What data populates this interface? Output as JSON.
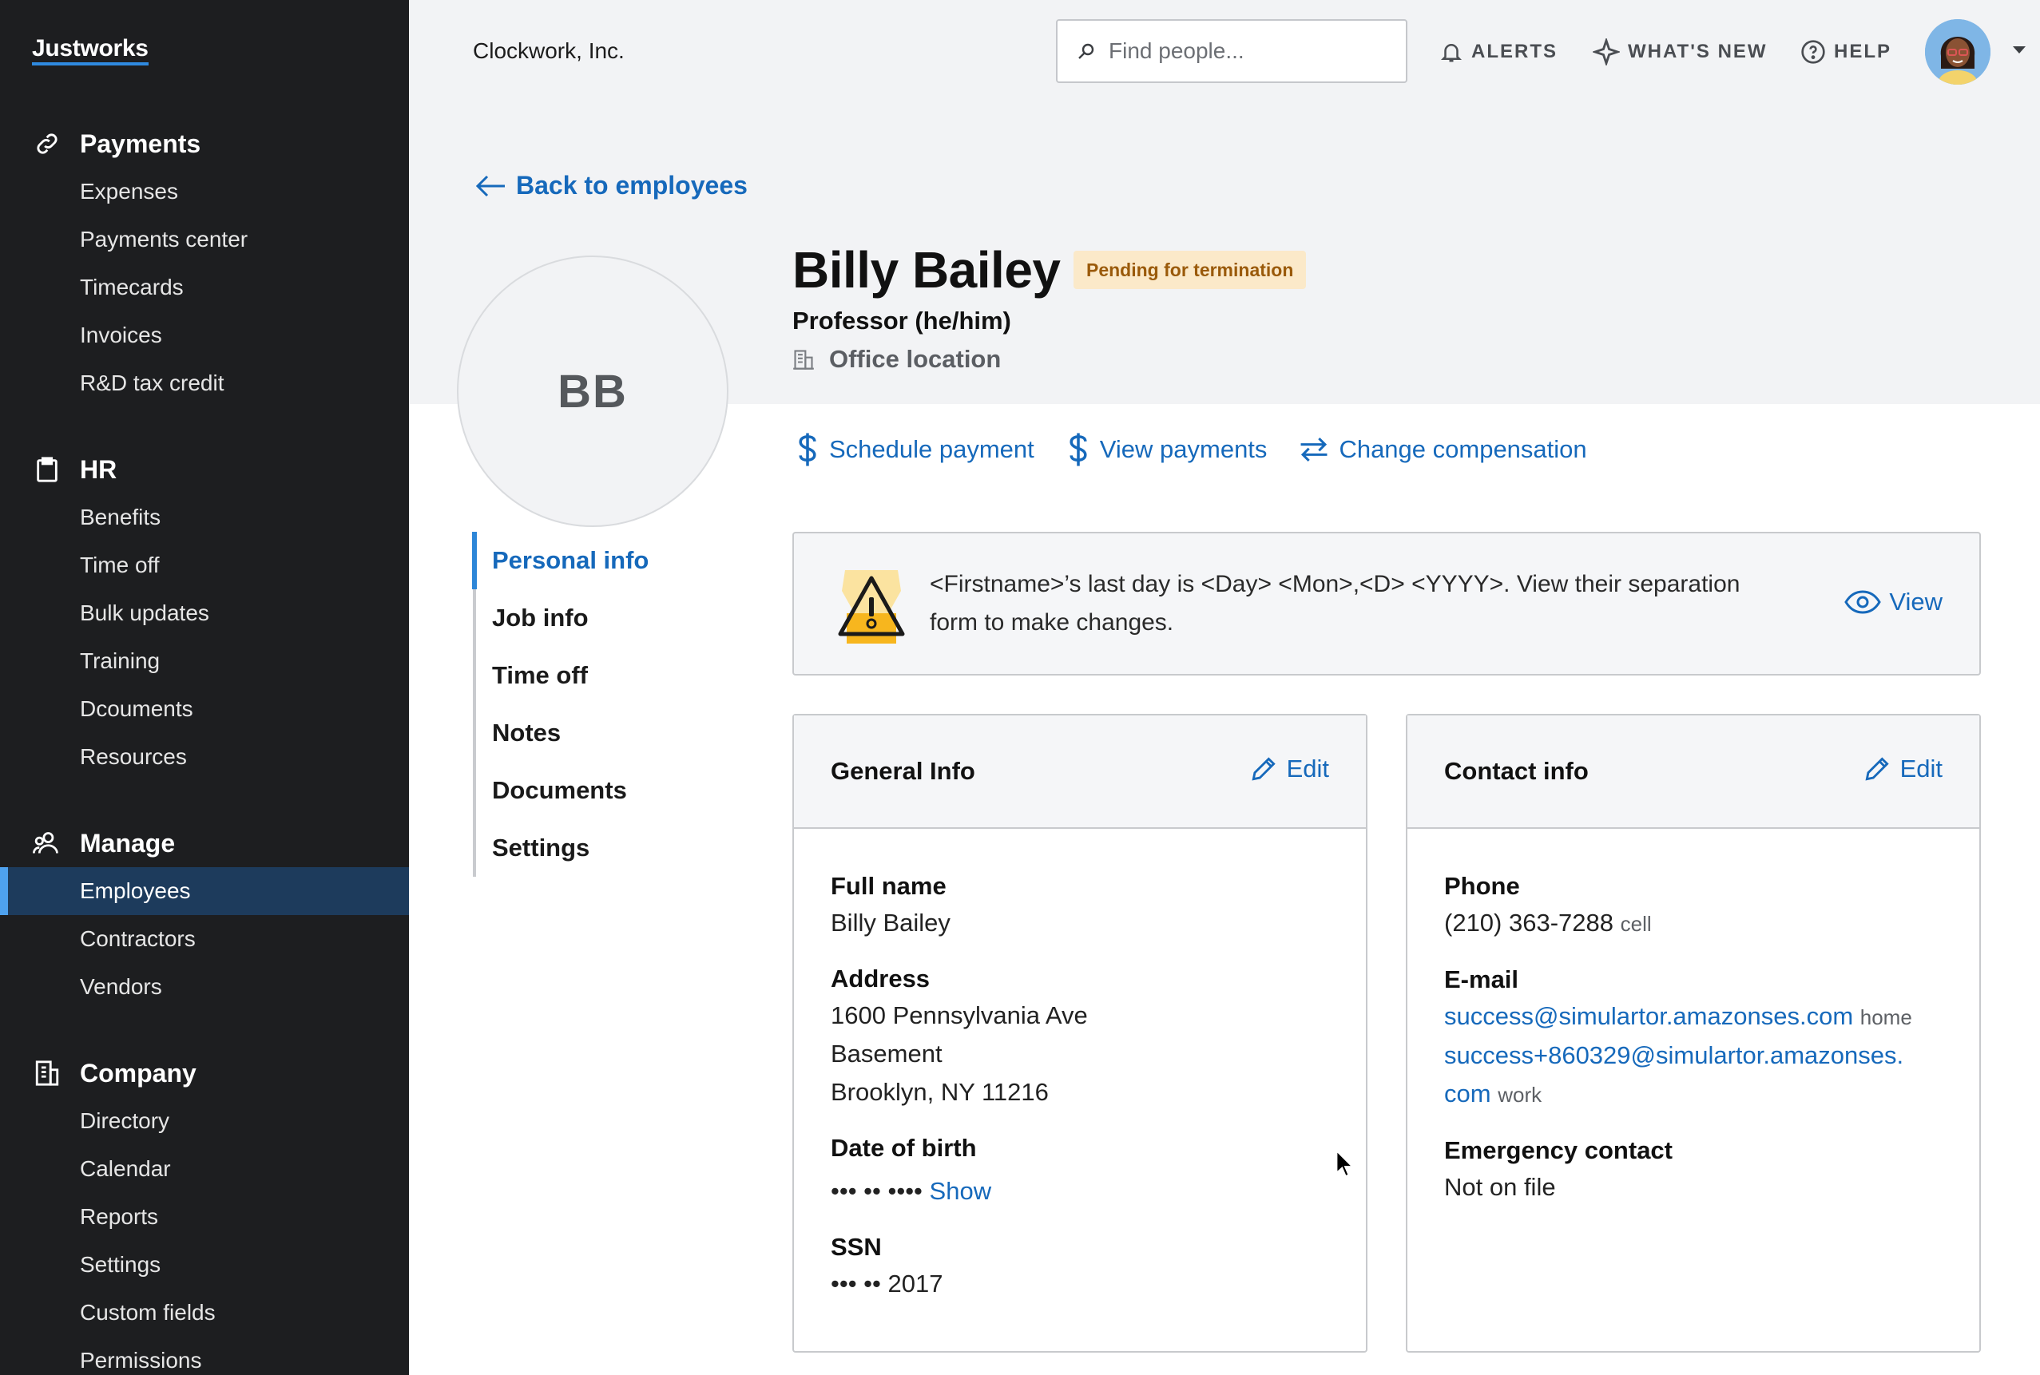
{
  "app": {
    "logo": "Justworks",
    "company": "Clockwork, Inc."
  },
  "sidebar": {
    "sections": [
      {
        "title": "Payments",
        "icon": "link-icon",
        "items": [
          "Expenses",
          "Payments center",
          "Timecards",
          "Invoices",
          "R&D tax credit"
        ]
      },
      {
        "title": "HR",
        "icon": "clipboard-icon",
        "items": [
          "Benefits",
          "Time off",
          "Bulk updates",
          "Training",
          "Dcouments",
          "Resources"
        ]
      },
      {
        "title": "Manage",
        "icon": "people-icon",
        "items": [
          "Employees",
          "Contractors",
          "Vendors"
        ],
        "active": "Employees"
      },
      {
        "title": "Company",
        "icon": "building-icon",
        "items": [
          "Directory",
          "Calendar",
          "Reports",
          "Settings",
          "Custom fields",
          "Permissions"
        ]
      }
    ]
  },
  "topbar": {
    "search_placeholder": "Find people...",
    "alerts": "ALERTS",
    "whats_new": "WHAT'S NEW",
    "help": "HELP"
  },
  "employee": {
    "back_label": "Back to employees",
    "initials": "BB",
    "name": "Billy Bailey",
    "status": "Pending for termination",
    "title": "Professor (he/him)",
    "location": "Office location"
  },
  "actions": {
    "schedule_payment": "Schedule payment",
    "view_payments": "View payments",
    "change_compensation": "Change compensation"
  },
  "tabs": [
    "Personal info",
    "Job info",
    "Time off",
    "Notes",
    "Documents",
    "Settings"
  ],
  "active_tab": "Personal info",
  "alert": {
    "text": "<Firstname>’s last day is <Day> <Mon>,<D> <YYYY>. View their separation form to make changes.",
    "view_label": "View"
  },
  "general_info": {
    "title": "General Info",
    "edit_label": "Edit",
    "full_name_label": "Full name",
    "full_name": "Billy Bailey",
    "address_label": "Address",
    "address_line1": "1600 Pennsylvania Ave",
    "address_line2": "Basement",
    "address_line3": "Brooklyn, NY 11216",
    "dob_label": "Date of birth",
    "dob_masked": "••• •• ••••",
    "dob_show": "Show",
    "ssn_label": "SSN",
    "ssn_masked": "••• ••",
    "ssn_last4": "2017"
  },
  "contact_info": {
    "title": "Contact info",
    "edit_label": "Edit",
    "phone_label": "Phone",
    "phone": "(210) 363-7288",
    "phone_type": "cell",
    "email_label": "E-mail",
    "email_home": "success@simulartor.amazonses.com",
    "email_home_type": "home",
    "email_work_line1": "success+860329@simulartor.amazonses.",
    "email_work_line2": "com",
    "email_work_type": "work",
    "emergency_label": "Emergency contact",
    "emergency_value": "Not on file"
  },
  "colors": {
    "accent": "#1669bb",
    "sidebar_bg": "#1d1e20",
    "badge_bg": "#fbe9c9",
    "badge_text": "#9a5a0a"
  }
}
